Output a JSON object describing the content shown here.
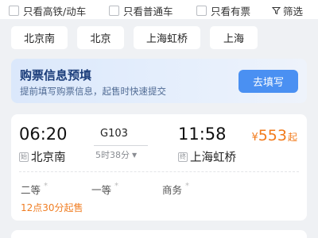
{
  "filters": {
    "options": [
      "只看高铁/动车",
      "只看普通车",
      "只看有票"
    ],
    "filter_label": "筛选"
  },
  "stations": [
    "北京南",
    "北京",
    "上海虹桥",
    "上海"
  ],
  "promo": {
    "title": "购票信息预填",
    "subtitle": "提前填写购票信息，起售时快速提交",
    "button": "去填写"
  },
  "train": {
    "number": "G103",
    "departure_time": "06:20",
    "arrival_time": "11:58",
    "duration": "5时38分",
    "from_tag": "始",
    "from_station": "北京南",
    "to_tag": "终",
    "to_station": "上海虹桥",
    "price_currency": "¥",
    "price_value": "553",
    "price_suffix": "起",
    "seats": [
      "二等",
      "一等",
      "商务"
    ],
    "seat_mark": "*",
    "presale": "12点30分起售"
  },
  "colors": {
    "accent_blue": "#4a90f2",
    "price_orange": "#f27a1a",
    "promo_title": "#1b3d7a"
  }
}
